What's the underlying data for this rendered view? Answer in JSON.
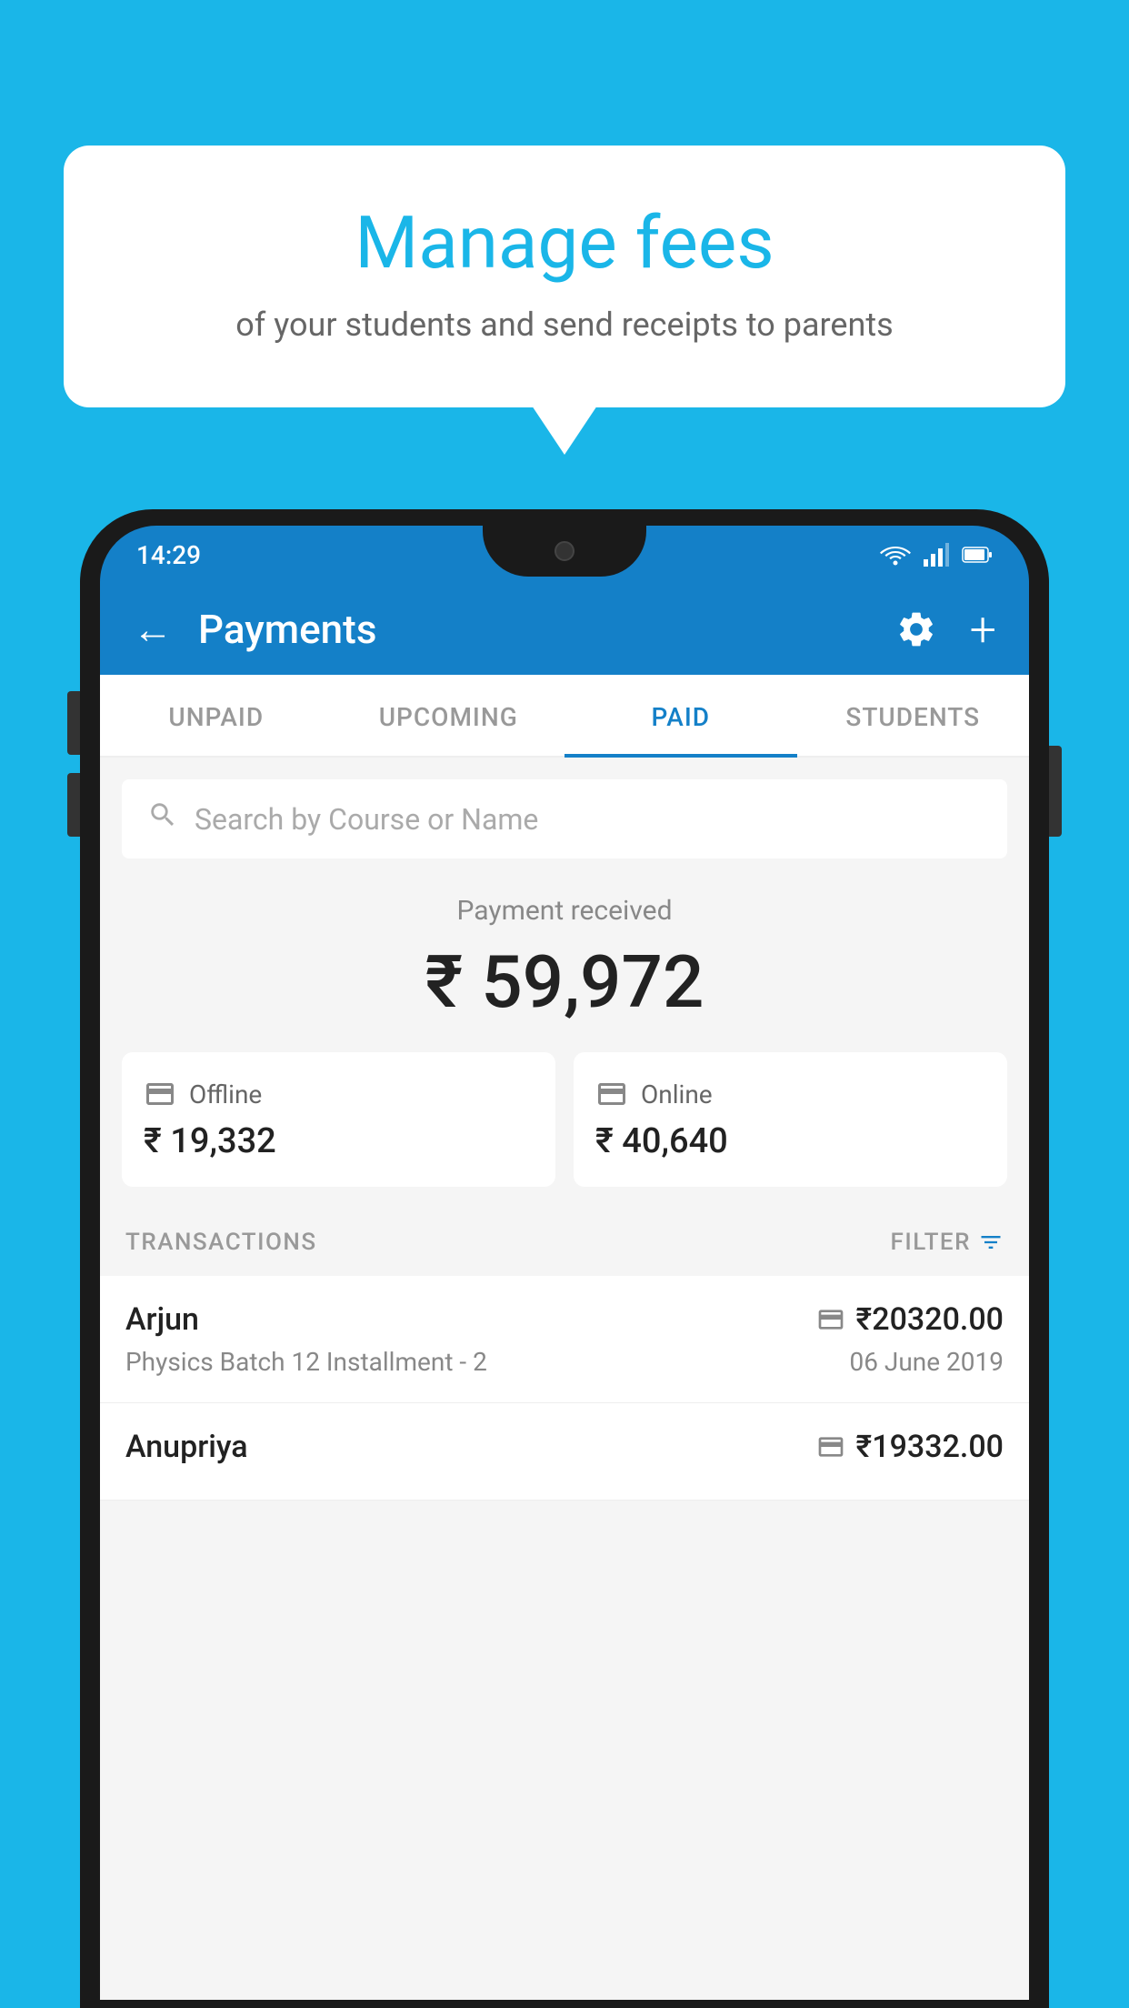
{
  "background_color": "#1ab6e8",
  "bubble": {
    "title": "Manage fees",
    "subtitle": "of your students and send receipts to parents"
  },
  "status_bar": {
    "time": "14:29",
    "icons": [
      "wifi",
      "signal",
      "battery"
    ]
  },
  "app_bar": {
    "title": "Payments",
    "back_icon": "←",
    "settings_icon": "⚙",
    "add_icon": "+"
  },
  "tabs": [
    {
      "label": "UNPAID",
      "active": false
    },
    {
      "label": "UPCOMING",
      "active": false
    },
    {
      "label": "PAID",
      "active": true
    },
    {
      "label": "STUDENTS",
      "active": false
    }
  ],
  "search": {
    "placeholder": "Search by Course or Name"
  },
  "payment_summary": {
    "label": "Payment received",
    "amount": "₹ 59,972",
    "offline": {
      "icon": "💴",
      "label": "Offline",
      "amount": "₹ 19,332"
    },
    "online": {
      "icon": "💳",
      "label": "Online",
      "amount": "₹ 40,640"
    }
  },
  "transactions": {
    "header_label": "TRANSACTIONS",
    "filter_label": "FILTER",
    "rows": [
      {
        "name": "Arjun",
        "course": "Physics Batch 12 Installment - 2",
        "amount": "₹20320.00",
        "date": "06 June 2019",
        "payment_type": "online"
      },
      {
        "name": "Anupriya",
        "course": "",
        "amount": "₹19332.00",
        "date": "",
        "payment_type": "offline"
      }
    ]
  }
}
